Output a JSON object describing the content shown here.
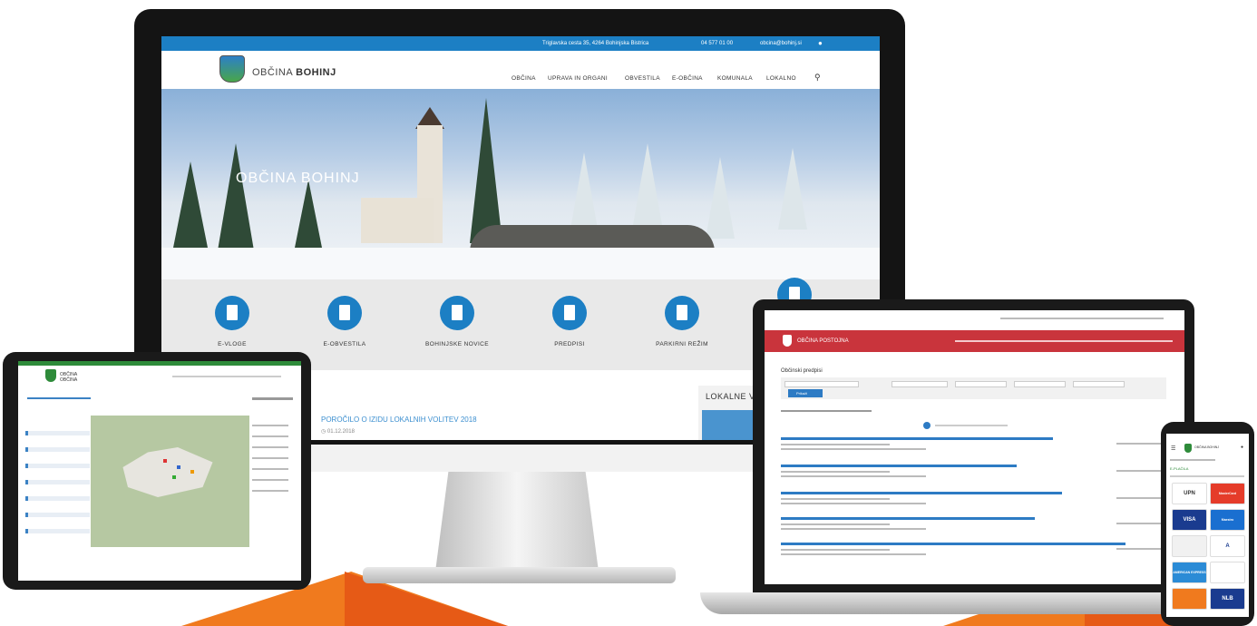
{
  "monitor": {
    "topbar": {
      "address": "Triglavska cesta 35, 4264 Bohinjska Bistrica",
      "phone": "04 577 01 00",
      "email": "obcina@bohinj.si",
      "user_icon": "user-icon"
    },
    "brand_prefix": "OBČINA",
    "brand_name": "BOHINJ",
    "nav": [
      "OBČINA",
      "UPRAVA IN ORGANI",
      "OBVESTILA",
      "E-OBČINA",
      "KOMUNALA",
      "LOKALNO"
    ],
    "search_icon": "search-icon",
    "hero_title": "OBČINA BOHINJ",
    "services": [
      {
        "label": "E-VLOGE",
        "icon": "document-icon"
      },
      {
        "label": "E-OBVESTILA",
        "icon": "documents-icon"
      },
      {
        "label": "BOHINJSKE NOVICE",
        "icon": "book-icon"
      },
      {
        "label": "PREDPISI",
        "icon": "file-icon"
      },
      {
        "label": "PARKIRNI REŽIM",
        "icon": "car-icon"
      }
    ],
    "news_title": "POROČILO O IZIDU LOKALNIH VOLITEV 2018",
    "news_date": "01.12.2018",
    "sidebar_title": "LOKALNE VO"
  },
  "tablet": {
    "brand": "OBČINA",
    "brand_sub": "OBČINA"
  },
  "laptop": {
    "brand": "OBČINA POSTOJNA",
    "page_title": "Občinski predpisi",
    "button": "Prikaži"
  },
  "phone": {
    "brand": "OBČINA BOHINJ",
    "heading": "E-PLAČILA",
    "cards": [
      {
        "label": "UPN",
        "color": "#ffffff",
        "text": "#333333"
      },
      {
        "label": "MasterCard",
        "color": "#e53c2a",
        "text": "#ffffff"
      },
      {
        "label": "VISA",
        "color": "#1a3b8f",
        "text": "#ffffff"
      },
      {
        "label": "Maestro",
        "color": "#1a6fd0",
        "text": "#ffffff"
      },
      {
        "label": "",
        "color": "#f1f1f1",
        "text": "#cc2222"
      },
      {
        "label": "A",
        "color": "#ffffff",
        "text": "#1a3b8f"
      },
      {
        "label": "AMERICAN EXPRESS",
        "color": "#2b8bd6",
        "text": "#ffffff"
      },
      {
        "label": "",
        "color": "#ffffff",
        "text": "#1a3b8f"
      },
      {
        "label": "",
        "color": "#f07a1e",
        "text": "#ffffff"
      },
      {
        "label": "NLB",
        "color": "#1a3b8f",
        "text": "#ffffff"
      }
    ]
  },
  "colors": {
    "accent_blue": "#1c7fc4",
    "postojna_red": "#c9343c",
    "green": "#2e8b3a",
    "orange": "#f07a1e"
  }
}
